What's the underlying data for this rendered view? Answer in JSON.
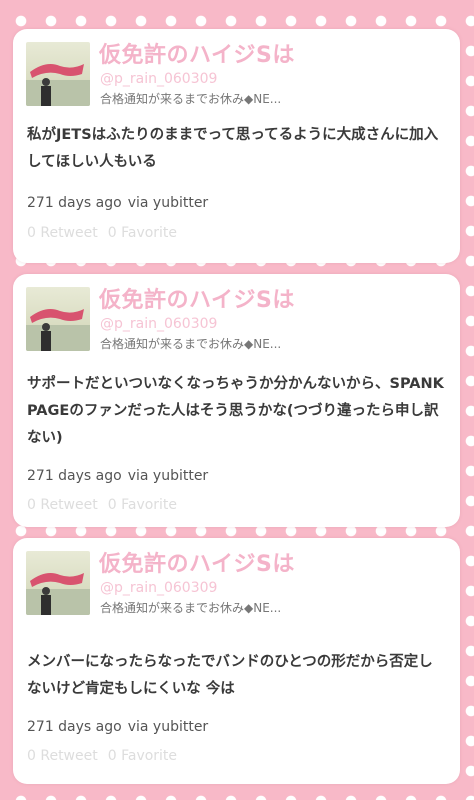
{
  "tweets": [
    {
      "display_name": "仮免許のハイジSは",
      "screen_name": "@p_rain_060309",
      "bio": "合格通知が来るまでお休み◆NE...",
      "text": "私がJETSはふたりのままでって思ってるように大成さんに加入してほしい人もいる",
      "time": "271 days ago",
      "via": "via yubitter",
      "retweet": "0 Retweet",
      "favorite": "0 Favorite"
    },
    {
      "display_name": "仮免許のハイジSは",
      "screen_name": "@p_rain_060309",
      "bio": "合格通知が来るまでお休み◆NE...",
      "text": "サポートだといついなくなっちゃうか分かんないから、SPANK PAGEのファンだった人はそう思うかな(つづり違ったら申し訳ない)",
      "time": "271 days ago",
      "via": "via yubitter",
      "retweet": "0 Retweet",
      "favorite": "0 Favorite"
    },
    {
      "display_name": "仮免許のハイジSは",
      "screen_name": "@p_rain_060309",
      "bio": "合格通知が来るまでお休み◆NE...",
      "text": "メンバーになったらなったでバンドのひとつの形だから否定しないけど肯定もしにくいな 今は",
      "time": "271 days ago",
      "via": "via yubitter",
      "retweet": "0 Retweet",
      "favorite": "0 Favorite"
    }
  ]
}
